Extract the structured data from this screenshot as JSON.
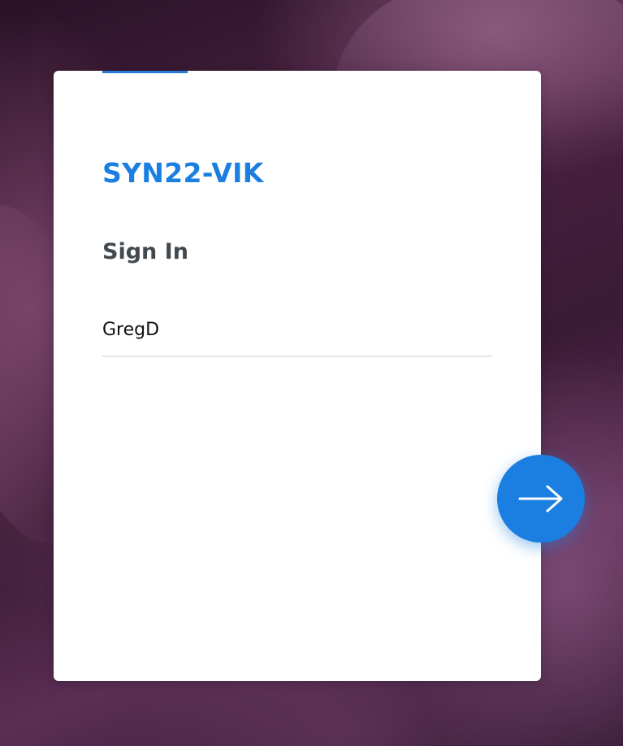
{
  "server": {
    "name": "SYN22-VIK"
  },
  "login": {
    "title": "Sign In",
    "username_value": "GregD"
  },
  "next_button": {
    "icon": "arrow-right-icon",
    "color": "#1a7fe0"
  },
  "colors": {
    "accent": "#1a7fe0",
    "title_text": "#414a50"
  }
}
